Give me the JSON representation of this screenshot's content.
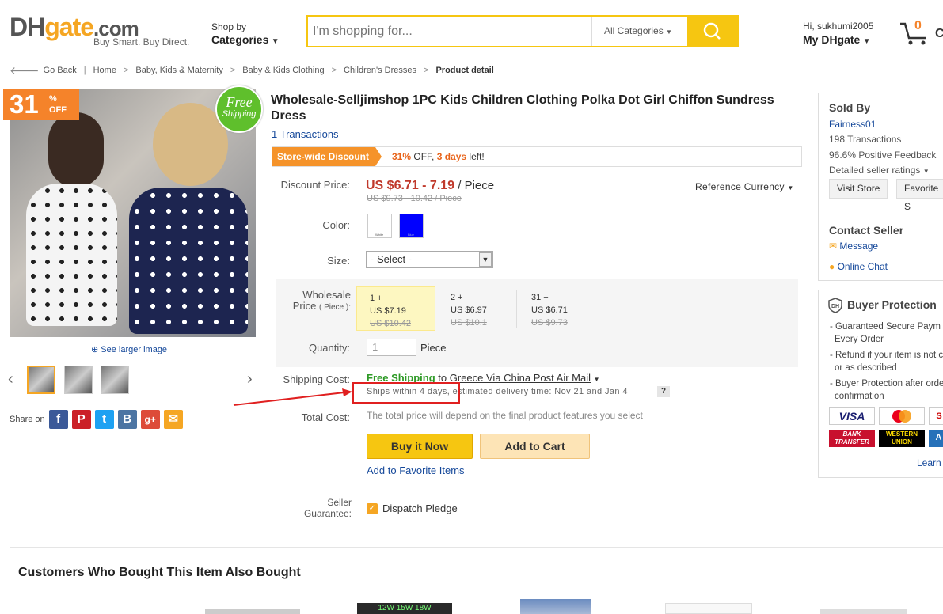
{
  "header": {
    "logo_main": "DHgate.com",
    "logo_tagline": "Buy Smart. Buy Direct.",
    "shop_by": "Shop by",
    "categories": "Categories",
    "search_placeholder": "I'm shopping for...",
    "search_category": "All Categories",
    "greeting": "Hi, sukhumi2005",
    "my_dhgate": "My DHgate",
    "cart_count": "0",
    "cart_label": "C"
  },
  "breadcrumb": {
    "go_back": "Go Back",
    "items": [
      "Home",
      "Baby, Kids & Maternity",
      "Baby & Kids Clothing",
      "Children's Dresses"
    ],
    "current": "Product detail"
  },
  "gallery": {
    "discount_number": "31",
    "discount_percent": "%",
    "discount_off": "OFF",
    "free": "Free",
    "shipping": "Shipping",
    "see_larger": "See larger image",
    "share_on": "Share on"
  },
  "product": {
    "title": "Wholesale-Selljimshop 1PC Kids Children Clothing Polka Dot Girl Chiffon Sundress Dress",
    "transactions": "1 Transactions",
    "store_discount_tag": "Store-wide Discount",
    "discount_pct": "31%",
    "discount_off": " OFF, ",
    "discount_days": "3 days",
    "discount_left": " left!",
    "discount_price_label": "Discount Price:",
    "price_range": "US $6.71 - 7.19",
    "price_unit": " / Piece",
    "old_price_range": "US $9.73 - 10.42 / Piece",
    "reference_currency": "Reference Currency",
    "color_label": "Color:",
    "color_options": [
      {
        "name": "White",
        "hex": "#ffffff"
      },
      {
        "name": "Blue",
        "hex": "#0000ff"
      }
    ],
    "size_label": "Size:",
    "size_selected": "- Select -",
    "wholesale_label_1": "Wholesale",
    "wholesale_label_2": "Price",
    "wholesale_label_unit": "( Piece ):",
    "tiers": [
      {
        "qty": "1 +",
        "price": "US $7.19",
        "old": "US $10.42"
      },
      {
        "qty": "2 +",
        "price": "US $6.97",
        "old": "US $10.1"
      },
      {
        "qty": "31 +",
        "price": "US $6.71",
        "old": "US $9.73"
      }
    ],
    "quantity_label": "Quantity:",
    "quantity_value": "1",
    "quantity_unit": "Piece",
    "shipping_cost_label": "Shipping Cost:",
    "free_shipping": "Free Shipping",
    "ship_to": " to ",
    "ship_via": "Greece Via China Post Air Mail",
    "ships_within": "Ships within 4 days,",
    "estimated": " estimated delivery time: Nov 21 and Jan 4",
    "question": "?",
    "total_cost_label": "Total Cost:",
    "total_note": "The total price will depend on the final product features you select",
    "buy_now": "Buy it Now",
    "add_to_cart": "Add to Cart",
    "add_favorite": "Add to Favorite Items",
    "seller_guarantee_1": "Seller",
    "seller_guarantee_2": "Guarantee:",
    "dispatch_pledge": "Dispatch Pledge"
  },
  "seller": {
    "sold_by": "Sold By",
    "name": "Fairness01",
    "transactions": "198 Transactions",
    "feedback": "96.6% Positive Feedback",
    "ratings": "Detailed seller ratings",
    "visit_store": "Visit Store",
    "favorite": "Favorite S",
    "contact": "Contact Seller",
    "message": "Message",
    "online_chat": "Online Chat"
  },
  "protection": {
    "title": "Buyer Protection",
    "items": [
      "- Guaranteed Secure Paym",
      "  Every Order",
      "- Refund if your item is not c",
      "  or as described",
      "- Buyer Protection after orde",
      "  confirmation"
    ],
    "payments": [
      "VISA",
      "",
      "",
      "BANK TRANSFER",
      "WESTERN UNION",
      ""
    ],
    "learn": "Learn"
  },
  "also_bought": {
    "title": "Customers Who Bought This Item Also Bought",
    "thumb_text": "12W 15W 18W"
  },
  "colors": {
    "accent_yellow": "#f6c611",
    "discount_orange": "#f5832a",
    "link_blue": "#15489a",
    "price_red": "#c0392b",
    "free_ship_green": "#2e9a26",
    "annotation_red": "#e02020"
  }
}
